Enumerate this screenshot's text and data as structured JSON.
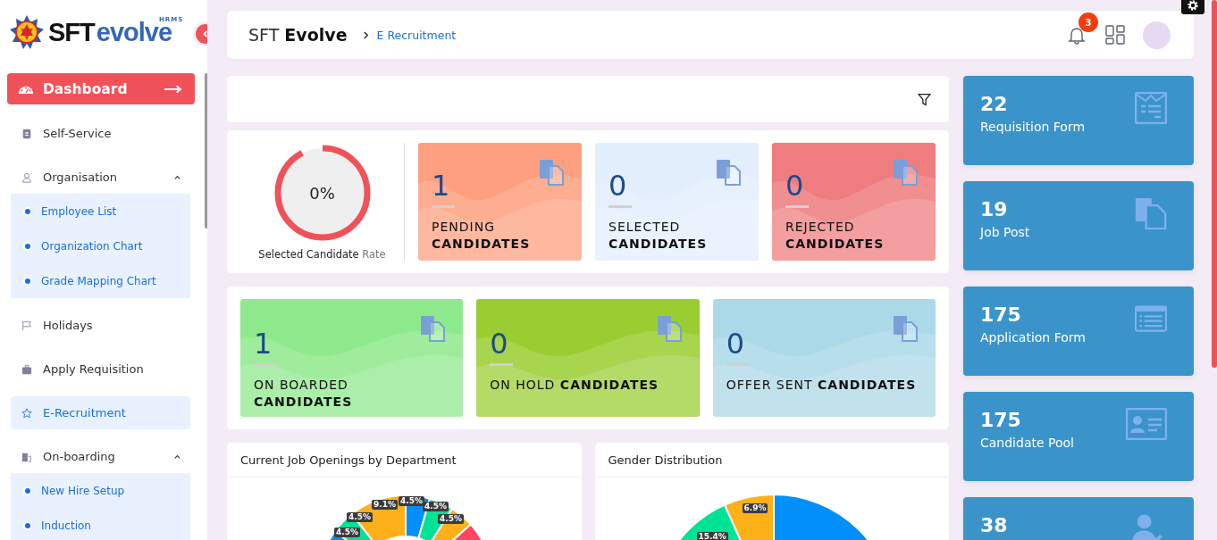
{
  "sidebar": {
    "logo": {
      "brand_dark": "SFT",
      "brand_light": "evolve",
      "tag": "HRMS"
    },
    "dashboard_button": "Dashboard",
    "items": [
      {
        "kind": "link",
        "label": "Self-Service",
        "selected": false
      },
      {
        "kind": "group",
        "label": "Organisation",
        "expanded": true,
        "children": [
          {
            "label": "Employee List"
          },
          {
            "label": "Organization Chart"
          },
          {
            "label": "Grade Mapping Chart"
          }
        ]
      },
      {
        "kind": "link",
        "label": "Holidays",
        "selected": false
      },
      {
        "kind": "link",
        "label": "Apply Requisition",
        "selected": false
      },
      {
        "kind": "link",
        "label": "E-Recruitment",
        "selected": true
      },
      {
        "kind": "group",
        "label": "On-boarding",
        "expanded": true,
        "children": [
          {
            "label": "New Hire Setup"
          },
          {
            "label": "Induction"
          }
        ]
      }
    ]
  },
  "header": {
    "title_light": "SFT",
    "title_bold": "Evolve",
    "breadcrumb": "E Recruitment",
    "notification_count": "3"
  },
  "rate": {
    "value": "0%",
    "label": "Selected Candidate",
    "label_suffix": "Rate"
  },
  "status_rows": [
    [
      {
        "count": "1",
        "word": "PENDING",
        "bold_word": "CANDIDATES",
        "same_line": false,
        "color": "#fea07f"
      },
      {
        "count": "0",
        "word": "SELECTED",
        "bold_word": "CANDIDATES",
        "same_line": false,
        "color": "#e3eefd"
      },
      {
        "count": "0",
        "word": "REJECTED",
        "bold_word": "CANDIDATES",
        "same_line": false,
        "color": "#ef7c7e"
      }
    ],
    [
      {
        "count": "1",
        "word": "ON BOARDED",
        "bold_word": "CANDIDATES",
        "same_line": false,
        "color": "#8ee98c"
      },
      {
        "count": "0",
        "word": "ON HOLD",
        "bold_word": "CANDIDATES",
        "same_line": true,
        "color": "#9acd32"
      },
      {
        "count": "0",
        "word": "OFFER SENT",
        "bold_word": "CANDIDATES",
        "same_line": true,
        "color": "#acd9e8"
      }
    ]
  ],
  "summary_cards": [
    {
      "kind": "requisition",
      "count": "22",
      "label": "Requisition Form"
    },
    {
      "kind": "job-post",
      "count": "19",
      "label": "Job Post"
    },
    {
      "kind": "application",
      "count": "175",
      "label": "Application Form"
    },
    {
      "kind": "candidate",
      "count": "175",
      "label": "Candidate Pool"
    },
    {
      "kind": "rejected",
      "count": "38"
    }
  ],
  "charts": [
    {
      "title": "Current Job Openings by Department",
      "slice_labels": [
        "4.5%",
        "4.5%",
        "9.1%",
        "4.5%",
        "4.5%",
        "4.5%"
      ]
    },
    {
      "title": "Gender Distribution",
      "slice_labels": [
        "15.4%",
        "6.9%"
      ]
    }
  ]
}
